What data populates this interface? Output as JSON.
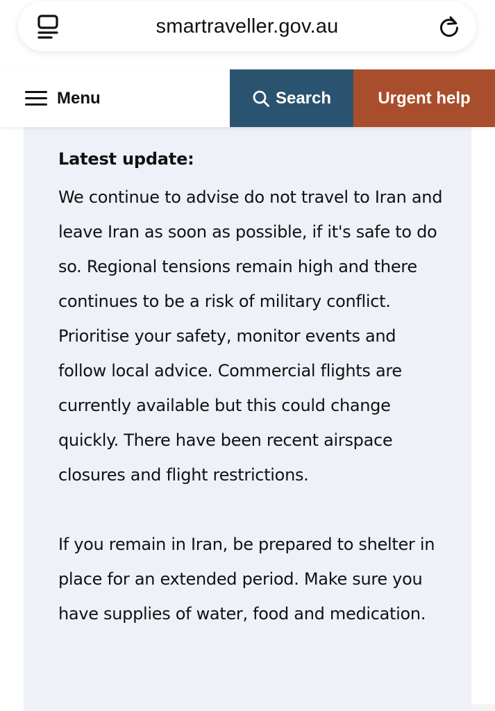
{
  "browser": {
    "url": "smartraveller.gov.au"
  },
  "header": {
    "menu_label": "Menu",
    "search_label": "Search",
    "urgent_label": "Urgent help",
    "search_color": "#2a5370",
    "urgent_color": "#a94e2c"
  },
  "alert": {
    "heading": "Latest update:",
    "paragraph1": "We continue to advise do not travel to Iran and leave Iran as soon as possible, if it's safe to do so. Regional tensions remain high and there continues to be a risk of military conflict. Prioritise your safety, monitor events and follow local advice. Commercial flights are currently available but this could change quickly. There have been recent airspace closures and flight restrictions.",
    "paragraph2": "If you remain in Iran, be prepared to shelter in place for an extended period. Make sure you have supplies of water, food and medication.",
    "background_color": "#eef1f7"
  },
  "icons": {
    "tabs": "tabs-icon",
    "reload": "reload-icon",
    "hamburger": "hamburger-icon",
    "search": "search-icon"
  }
}
